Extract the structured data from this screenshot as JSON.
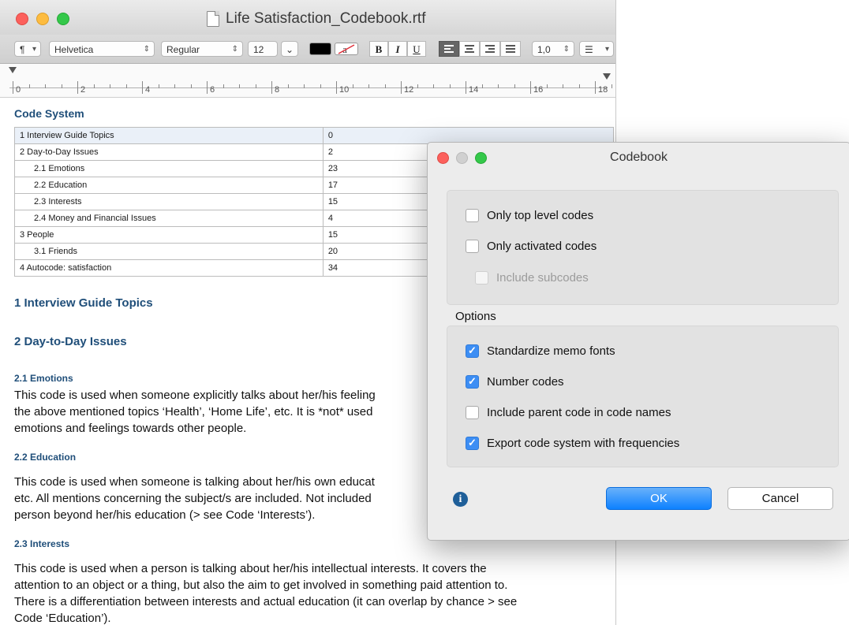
{
  "window": {
    "title": "Life Satisfaction_Codebook.rtf"
  },
  "toolbar": {
    "paragraph": "¶",
    "font_family": "Helvetica",
    "font_style": "Regular",
    "font_size": "12",
    "bold": "B",
    "italic": "I",
    "underline": "U",
    "line_spacing": "1,0",
    "list_icon": "list-bullets-icon",
    "text_color": "#000000",
    "highlight_color": "#ffffff"
  },
  "ruler": {
    "labels": [
      "0",
      "2",
      "4",
      "6",
      "8",
      "10",
      "12",
      "14",
      "16",
      "18"
    ]
  },
  "code_system": {
    "heading": "Code System",
    "rows": [
      {
        "name": "1 Interview Guide Topics",
        "value": "0",
        "indent": false
      },
      {
        "name": "2 Day-to-Day Issues",
        "value": "2",
        "indent": false
      },
      {
        "name": "2.1 Emotions",
        "value": "23",
        "indent": true
      },
      {
        "name": "2.2 Education",
        "value": "17",
        "indent": true
      },
      {
        "name": "2.3 Interests",
        "value": "15",
        "indent": true
      },
      {
        "name": "2.4 Money and Financial Issues",
        "value": "4",
        "indent": true
      },
      {
        "name": "3 People",
        "value": "15",
        "indent": false
      },
      {
        "name": "3.1 Friends",
        "value": "20",
        "indent": true
      },
      {
        "name": "4 Autocode: satisfaction",
        "value": "34",
        "indent": false
      }
    ]
  },
  "doc": {
    "h_1": "1 Interview Guide Topics",
    "h_2": "2 Day-to-Day Issues",
    "h_21": "2.1 Emotions",
    "p_21": [
      "This code is used when someone explicitly talks about her/his feeling",
      "the above mentioned topics ‘Health’, ‘Home Life’, etc. It is *not* used",
      "emotions and feelings towards other people."
    ],
    "h_22": "2.2 Education",
    "p_22": [
      "This code is used when someone is talking about her/his own educat",
      "etc. All mentions concerning the subject/s are included. Not included",
      "person beyond her/his education (> see Code ‘Interests’)."
    ],
    "h_23": "2.3 Interests",
    "p_23": [
      "This code is used when a person is talking about her/his intellectual interests. It covers the",
      "attention to an object or a thing, but also the aim to get involved in something paid attention to.",
      "There is a differentiation between interests and actual education (it can overlap by chance > see",
      "Code ‘Education’)."
    ]
  },
  "dialog": {
    "title": "Codebook",
    "only_top": {
      "label": "Only top level codes",
      "checked": false
    },
    "only_activated": {
      "label": "Only activated codes",
      "checked": false
    },
    "include_sub": {
      "label": "Include subcodes",
      "checked": false,
      "disabled": true
    },
    "options_label": "Options",
    "std_memo": {
      "label": "Standardize memo fonts",
      "checked": true
    },
    "number_codes": {
      "label": "Number codes",
      "checked": true
    },
    "parent_names": {
      "label": "Include parent code in code names",
      "checked": false
    },
    "export_freq": {
      "label": "Export code system with frequencies",
      "checked": true
    },
    "info_icon": "info-icon",
    "ok": "OK",
    "cancel": "Cancel",
    "accent": "#3d8ef4"
  }
}
